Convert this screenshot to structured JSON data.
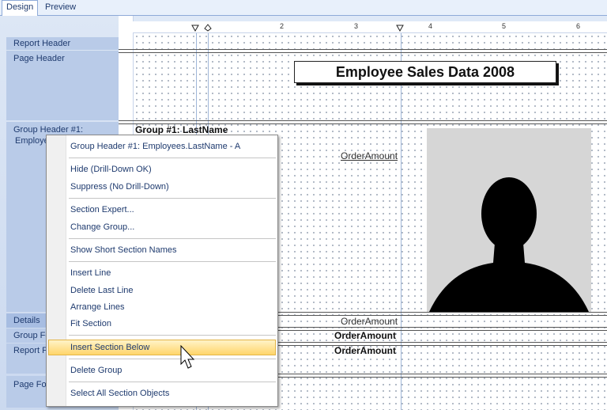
{
  "tabs": [
    {
      "label": "Design",
      "active": true
    },
    {
      "label": "Preview",
      "active": false
    }
  ],
  "ruler": {
    "numbers": [
      "2",
      "3",
      "4",
      "5",
      "6"
    ]
  },
  "sections": {
    "report_header": "Report Header",
    "page_header": "Page Header",
    "group_header_1": "Group Header #1:",
    "group_header_1_sub": "Employe",
    "details": "Details",
    "group_footer": "Group Fo",
    "report_footer": "Report F",
    "page_footer": "Page Fo"
  },
  "report": {
    "title": "Employee Sales Data 2008",
    "group_field": "Group #1: LastName",
    "order_amount_header": "OrderAmount",
    "order_amount_details": "OrderAmount",
    "order_amount_sum1": "OrderAmount",
    "order_amount_sum2": "OrderAmount"
  },
  "context_menu": {
    "items": [
      {
        "label": "Group Header #1: Employees.LastName - A"
      },
      {
        "label": "Hide (Drill-Down OK)"
      },
      {
        "label": "Suppress (No Drill-Down)"
      },
      {
        "label": "Section Expert..."
      },
      {
        "label": "Change Group..."
      },
      {
        "label": "Show Short Section Names"
      },
      {
        "label": "Insert Line"
      },
      {
        "label": "Delete Last Line"
      },
      {
        "label": "Arrange Lines"
      },
      {
        "label": "Fit Section"
      },
      {
        "label": "Insert Section Below",
        "highlighted": true
      },
      {
        "label": "Delete Group"
      },
      {
        "label": "Select All Section Objects"
      }
    ]
  },
  "colors": {
    "menu_highlight": "#ffd56a",
    "panel": "#cbd9ef",
    "ui_text": "#1e3a6e"
  }
}
